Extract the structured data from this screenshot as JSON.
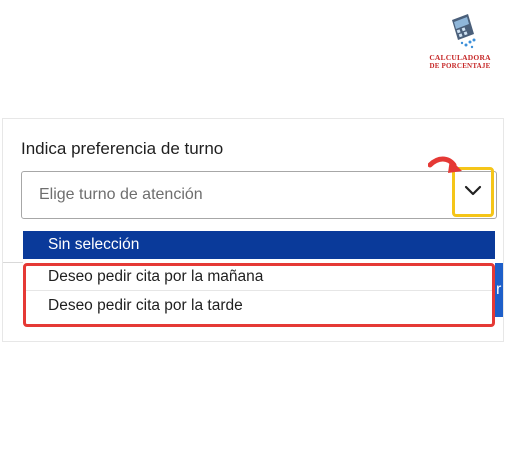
{
  "logo": {
    "line1": "CALCULADORA",
    "line2": "DE PORCENTAJE",
    "brand_red": "#c62828",
    "icon": "calculator-logo-icon"
  },
  "form": {
    "label": "Indica preferencia de turno",
    "select_placeholder": "Elige turno de atención",
    "dropdown_icon": "chevron-down-icon",
    "options": [
      {
        "label": "Sin selección",
        "selected": true
      },
      {
        "label": "Deseo pedir cita por la mañana",
        "selected": false
      },
      {
        "label": "Deseo pedir cita por la tarde",
        "selected": false
      }
    ],
    "behind_button_glyph": "r"
  },
  "colors": {
    "selected_option_bg": "#0a3a9a",
    "annotation_yellow": "#f5c518",
    "annotation_red": "#e53935",
    "arrow_color": "#e53935"
  }
}
